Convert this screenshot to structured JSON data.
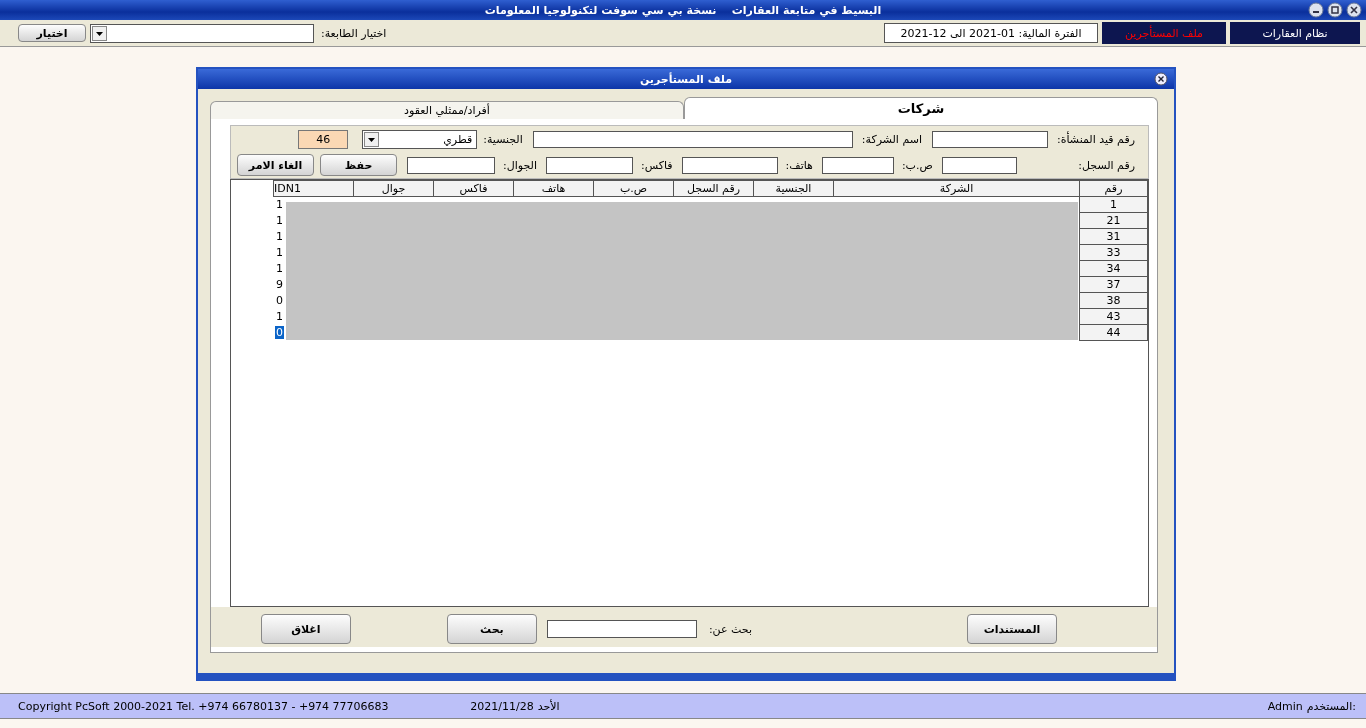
{
  "window": {
    "title": "البسيط في متابعة العقارات    نسخة بي سي سوفت لتكنولوجيا المعلومات"
  },
  "toolbar": {
    "system_label": "نظام العقارات",
    "module_label": "ملف المستأجرين",
    "period": "الفترة المالية: 01-2021 الى 12-2021",
    "printer_label": "اختيار الطابعة:",
    "choose_button": "اختيار"
  },
  "dialog": {
    "title": "ملف المستأجرين",
    "tabs": [
      {
        "label": "شركات",
        "selected": true
      },
      {
        "label": "أفراد/ممثلي العقود",
        "selected": false
      }
    ],
    "form": {
      "establishment_label": "رقم قيد المنشأة:",
      "company_label": "اسم الشركة:",
      "nationality_label": "الجنسية:",
      "nationality_value": "قطري",
      "count": "46",
      "registry_label": "رقم السجل:",
      "pobox_label": "ص.ب:",
      "phone_label": "هاتف:",
      "fax_label": "فاكس:",
      "mobile_label": "الجوال:",
      "save_button": "حفظ",
      "cancel_button": "الغاء الامر"
    },
    "table": {
      "columns": [
        "رقم",
        "الشركة",
        "الجنسية",
        "رقم السجل",
        "ص.ب",
        "هاتف",
        "فاكس",
        "جوال",
        "IDN1"
      ],
      "rows": [
        {
          "number": "1",
          "idn1": "1",
          "selected": false
        },
        {
          "number": "21",
          "idn1": "1",
          "selected": false
        },
        {
          "number": "31",
          "idn1": "1",
          "selected": false
        },
        {
          "number": "33",
          "idn1": "1",
          "selected": false
        },
        {
          "number": "34",
          "idn1": "1",
          "selected": false
        },
        {
          "number": "37",
          "idn1": "9",
          "selected": false
        },
        {
          "number": "38",
          "idn1": "0",
          "selected": false
        },
        {
          "number": "43",
          "idn1": "1",
          "selected": false
        },
        {
          "number": "44",
          "idn1": "0",
          "selected": true
        }
      ]
    },
    "footer": {
      "documents_button": "المستندات",
      "search_label": "بحث عن:",
      "search_button": "بحث",
      "close_button": "اغلاق"
    }
  },
  "status_bar": {
    "user_label": "المستخدم:",
    "user": "Admin",
    "day": "الأحد",
    "date": "2021/11/28",
    "copyright": "Copyright PcSoft 2000-2021 Tel. +974 66780137 - +974 77706683"
  }
}
